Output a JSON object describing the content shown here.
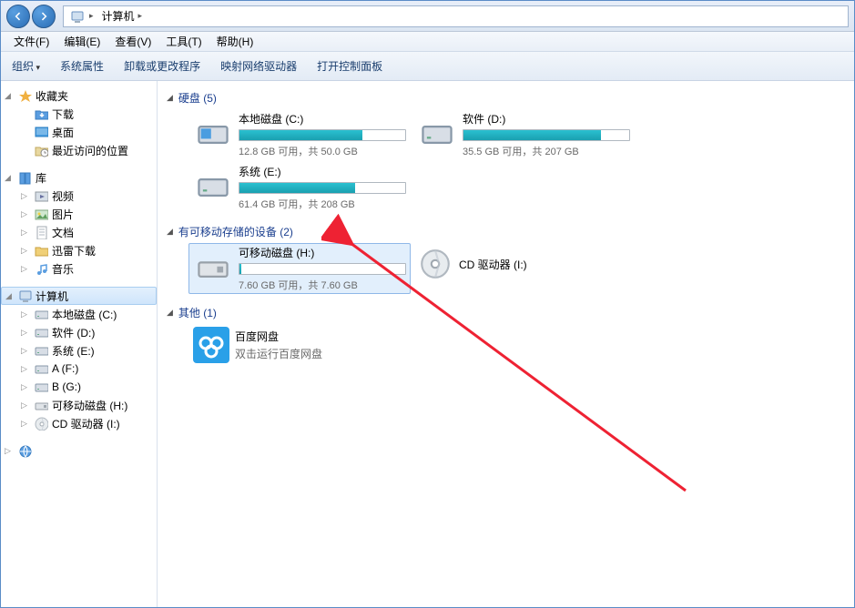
{
  "address": {
    "location": "计算机"
  },
  "menubar": [
    {
      "label": "文件(F)"
    },
    {
      "label": "编辑(E)"
    },
    {
      "label": "查看(V)"
    },
    {
      "label": "工具(T)"
    },
    {
      "label": "帮助(H)"
    }
  ],
  "toolbar": [
    {
      "label": "组织",
      "dropdown": true
    },
    {
      "label": "系统属性"
    },
    {
      "label": "卸载或更改程序"
    },
    {
      "label": "映射网络驱动器"
    },
    {
      "label": "打开控制面板"
    }
  ],
  "sidebar": {
    "favorites": {
      "label": "收藏夹",
      "items": [
        {
          "icon": "download",
          "label": "下载"
        },
        {
          "icon": "desktop",
          "label": "桌面"
        },
        {
          "icon": "recent",
          "label": "最近访问的位置"
        }
      ]
    },
    "libraries": {
      "label": "库",
      "items": [
        {
          "icon": "video",
          "label": "视频"
        },
        {
          "icon": "pictures",
          "label": "图片"
        },
        {
          "icon": "documents",
          "label": "文档"
        },
        {
          "icon": "xunlei",
          "label": "迅雷下载"
        },
        {
          "icon": "music",
          "label": "音乐"
        }
      ]
    },
    "computer": {
      "label": "计算机",
      "items": [
        {
          "icon": "drive",
          "label": "本地磁盘 (C:)"
        },
        {
          "icon": "drive",
          "label": "软件 (D:)"
        },
        {
          "icon": "drive",
          "label": "系统 (E:)"
        },
        {
          "icon": "drive",
          "label": "A (F:)"
        },
        {
          "icon": "drive",
          "label": "B (G:)"
        },
        {
          "icon": "removable",
          "label": "可移动磁盘 (H:)"
        },
        {
          "icon": "cdrom",
          "label": "CD 驱动器 (I:)"
        }
      ]
    },
    "network": {
      "label": ""
    }
  },
  "content": {
    "hard_drives": {
      "header": "硬盘 (5)",
      "items": [
        {
          "name": "本地磁盘 (C:)",
          "caption": "12.8 GB 可用，共 50.0 GB",
          "used_pct": 74,
          "icon": "drive-win"
        },
        {
          "name": "软件 (D:)",
          "caption": "35.5 GB 可用，共 207 GB",
          "used_pct": 83,
          "icon": "drive"
        },
        {
          "name": "系统 (E:)",
          "caption": "61.4 GB 可用，共 208 GB",
          "used_pct": 70,
          "icon": "drive"
        }
      ]
    },
    "removable": {
      "header": "有可移动存储的设备 (2)",
      "items": [
        {
          "name": "可移动磁盘 (H:)",
          "caption": "7.60 GB 可用，共 7.60 GB",
          "used_pct": 1,
          "icon": "removable",
          "selected": true
        },
        {
          "name": "CD 驱动器 (I:)",
          "icon": "cdrom"
        }
      ]
    },
    "other": {
      "header": "其他 (1)",
      "items": [
        {
          "name": "百度网盘",
          "sub": "双击运行百度网盘",
          "icon": "baidu"
        }
      ]
    }
  }
}
